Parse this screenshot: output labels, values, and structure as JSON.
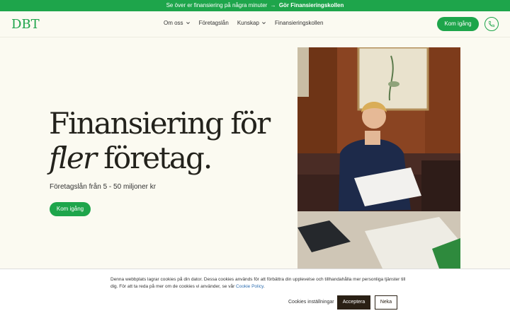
{
  "promo": {
    "text": "Se över er finansiering på några minuter",
    "arrow": "→",
    "link": "Gör Finansieringskollen"
  },
  "nav": {
    "logo": "DBT",
    "menu": [
      {
        "label": "Om oss",
        "dropdown": true
      },
      {
        "label": "Företagslån",
        "dropdown": false
      },
      {
        "label": "Kunskap",
        "dropdown": true
      },
      {
        "label": "Finansieringskollen",
        "dropdown": false
      }
    ],
    "cta": "Kom igång"
  },
  "hero": {
    "title_line1": "Finansiering för",
    "title_italic": "fler",
    "title_line2_rest": "företag.",
    "subtitle": "Företagslån från 5 - 50 miljoner kr",
    "cta": "Kom igång"
  },
  "cookie": {
    "text": "Denna webbplats lagrar cookies på din dator. Dessa cookies används för att förbättra din upplevelse och tillhandahålla mer personliga tjänster till dig. För att ta reda på mer om de cookies vi använder, se vår",
    "link": "Cookie Policy",
    "after_link": ".",
    "settings": "Cookies inställningar",
    "accept": "Acceptera",
    "deny": "Neka"
  },
  "colors": {
    "brand_green": "#1ea54b",
    "background": "#fbfaf1",
    "dark": "#2a2015"
  }
}
